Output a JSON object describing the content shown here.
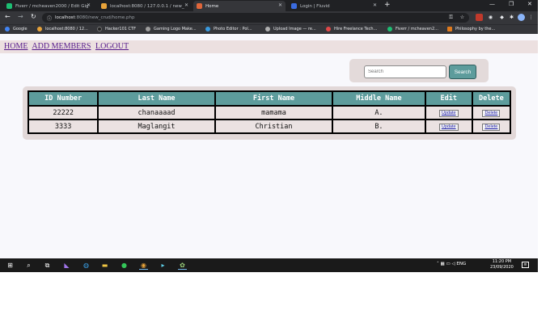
{
  "browser": {
    "tabs": [
      {
        "title": "Fiverr / mcheaven2000 / Edit Gig",
        "color": "#1dbf73"
      },
      {
        "title": "localhost:8080 / 127.0.0.1 / new_",
        "color": "#e8a33a"
      },
      {
        "title": "Home",
        "color": "#e0663a"
      },
      {
        "title": "Login | Fluvid",
        "color": "#3a6be0"
      }
    ],
    "address": {
      "host": "localhost",
      "path": ":8080/new_crud/home.php"
    },
    "bookmarks": [
      {
        "label": "Google",
        "color": "#4285f4"
      },
      {
        "label": "localhost:8080 / 12...",
        "color": "#e8a33a"
      },
      {
        "label": "Hacker101 CTF",
        "color": "#222222"
      },
      {
        "label": "Gaming Logo Make...",
        "color": "#9e9e9e"
      },
      {
        "label": "Photo Editor : Pol...",
        "color": "#3a9be0"
      },
      {
        "label": "Upload Image — re...",
        "color": "#b0b0b0"
      },
      {
        "label": "Hire Freelance Tech...",
        "color": "#e04848"
      },
      {
        "label": "Fiverr / mcheaven2...",
        "color": "#1dbf73"
      },
      {
        "label": "Philosophy by the...",
        "color": "#e07a1d"
      }
    ]
  },
  "nav": {
    "home": "HOME",
    "add_members": "ADD MEMBERS",
    "logout": "LOGOUT"
  },
  "search": {
    "placeholder": "Search",
    "button": "Search"
  },
  "table": {
    "headers": [
      "ID Number",
      "Last Name",
      "First Name",
      "Middle Name",
      "Edit",
      "Delete"
    ],
    "rows": [
      {
        "id": "22222",
        "last": "chanaaaad",
        "first": "mamama",
        "middle": "A.",
        "edit": "Update",
        "delete": "Delete"
      },
      {
        "id": "3333",
        "last": "Maglangit",
        "first": "Christian",
        "middle": "B.",
        "edit": "Update",
        "delete": "Delete"
      }
    ]
  },
  "taskbar": {
    "lang": "ENG",
    "time": "11:20 PM",
    "date": "23/09/2020"
  }
}
